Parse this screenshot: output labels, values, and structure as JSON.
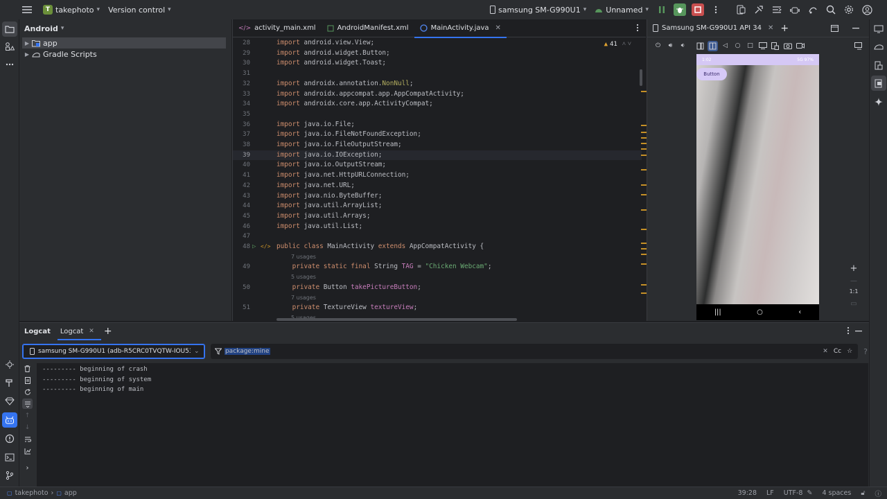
{
  "titlebar": {
    "project_badge": "T",
    "project_name": "takephoto",
    "vcs_label": "Version control",
    "device_name": "samsung SM-G990U1",
    "config_name": "Unnamed"
  },
  "project_panel": {
    "view_mode": "Android",
    "items": [
      {
        "label": "app"
      },
      {
        "label": "Gradle Scripts"
      }
    ]
  },
  "editor": {
    "tabs": [
      {
        "label": "activity_main.xml",
        "icon": "xml-file-icon"
      },
      {
        "label": "AndroidManifest.xml",
        "icon": "manifest-file-icon"
      },
      {
        "label": "MainActivity.java",
        "icon": "java-class-icon"
      }
    ],
    "warnings_count": "41",
    "lines": [
      {
        "n": "28",
        "code": [
          [
            "kw",
            "import "
          ],
          [
            "cls",
            "android.view.View;"
          ]
        ]
      },
      {
        "n": "29",
        "code": [
          [
            "kw",
            "import "
          ],
          [
            "cls",
            "android.widget.Button;"
          ]
        ]
      },
      {
        "n": "30",
        "code": [
          [
            "kw",
            "import "
          ],
          [
            "cls",
            "android.widget.Toast;"
          ]
        ]
      },
      {
        "n": "31",
        "code": []
      },
      {
        "n": "32",
        "code": [
          [
            "kw",
            "import "
          ],
          [
            "cls",
            "androidx.annotation."
          ],
          [
            "ann",
            "NonNull"
          ],
          [
            "cls",
            ";"
          ]
        ]
      },
      {
        "n": "33",
        "code": [
          [
            "kw",
            "import "
          ],
          [
            "cls",
            "androidx.appcompat.app.AppCompatActivity;"
          ]
        ]
      },
      {
        "n": "34",
        "code": [
          [
            "kw",
            "import "
          ],
          [
            "cls",
            "androidx.core.app.ActivityCompat;"
          ]
        ]
      },
      {
        "n": "35",
        "code": []
      },
      {
        "n": "36",
        "code": [
          [
            "kw",
            "import "
          ],
          [
            "cls",
            "java.io.File;"
          ]
        ]
      },
      {
        "n": "37",
        "code": [
          [
            "kw",
            "import "
          ],
          [
            "cls",
            "java.io.FileNotFoundException;"
          ]
        ]
      },
      {
        "n": "38",
        "code": [
          [
            "kw",
            "import "
          ],
          [
            "cls",
            "java.io.FileOutputStream;"
          ]
        ]
      },
      {
        "n": "39",
        "code": [
          [
            "kw",
            "import "
          ],
          [
            "cls",
            "java.io.IOException;"
          ]
        ],
        "current": true
      },
      {
        "n": "40",
        "code": [
          [
            "kw",
            "import "
          ],
          [
            "cls",
            "java.io.OutputStream;"
          ]
        ]
      },
      {
        "n": "41",
        "code": [
          [
            "kw",
            "import "
          ],
          [
            "cls",
            "java.net.HttpURLConnection;"
          ]
        ]
      },
      {
        "n": "42",
        "code": [
          [
            "kw",
            "import "
          ],
          [
            "cls",
            "java.net.URL;"
          ]
        ]
      },
      {
        "n": "43",
        "code": [
          [
            "kw",
            "import "
          ],
          [
            "cls",
            "java.nio.ByteBuffer;"
          ]
        ]
      },
      {
        "n": "44",
        "code": [
          [
            "kw",
            "import "
          ],
          [
            "cls",
            "java.util.ArrayList;"
          ]
        ]
      },
      {
        "n": "45",
        "code": [
          [
            "kw",
            "import "
          ],
          [
            "cls",
            "java.util.Arrays;"
          ]
        ]
      },
      {
        "n": "46",
        "code": [
          [
            "kw",
            "import "
          ],
          [
            "cls",
            "java.util.List;"
          ]
        ]
      },
      {
        "n": "47",
        "code": []
      },
      {
        "n": "48",
        "code": [
          [
            "kw",
            "public class "
          ],
          [
            "cls",
            "MainActivity "
          ],
          [
            "kw",
            "extends "
          ],
          [
            "cls",
            "AppCompatActivity {"
          ]
        ],
        "gutter_icons": true
      },
      {
        "n": "",
        "hint": "7 usages"
      },
      {
        "n": "49",
        "code": [
          [
            "cls",
            "    "
          ],
          [
            "kw",
            "private static final "
          ],
          [
            "cls",
            "String "
          ],
          [
            "fld",
            "TAG"
          ],
          [
            "cls",
            " = "
          ],
          [
            "str",
            "\"Chicken Webcam\""
          ],
          [
            "cls",
            ";"
          ]
        ]
      },
      {
        "n": "",
        "hint": "5 usages"
      },
      {
        "n": "50",
        "code": [
          [
            "cls",
            "    "
          ],
          [
            "kw",
            "private "
          ],
          [
            "cls",
            "Button "
          ],
          [
            "fld",
            "takePictureButton"
          ],
          [
            "cls",
            ";"
          ]
        ]
      },
      {
        "n": "",
        "hint": "7 usages"
      },
      {
        "n": "51",
        "code": [
          [
            "cls",
            "    "
          ],
          [
            "kw",
            "private "
          ],
          [
            "cls",
            "TextureView "
          ],
          [
            "fld",
            "textureView"
          ],
          [
            "cls",
            ";"
          ]
        ]
      },
      {
        "n": "",
        "hint": "5 usages"
      }
    ]
  },
  "emulator": {
    "tab_title": "Samsung SM-G990U1 API 34",
    "phone_status_left": "1:02",
    "phone_status_right": "5G 97%",
    "app_button_label": "Button",
    "zoom_reset_label": "1:1"
  },
  "logcat": {
    "title": "Logcat",
    "tab_label": "Logcat",
    "device_selector": "samsung SM-G990U1 (adb-R5CRC0TVQTW-IOU532.",
    "filter_value": "package:mine",
    "case_label": "Cc",
    "lines": [
      "--------- beginning of crash",
      "--------- beginning of system",
      "--------- beginning of main"
    ]
  },
  "statusbar": {
    "project": "takephoto",
    "module": "app",
    "position": "39:28",
    "line_ending": "LF",
    "encoding": "UTF-8",
    "indent": "4 spaces"
  },
  "colors": {
    "accent": "#3574f0",
    "run": "#57965c",
    "stop": "#c94f4f",
    "keyword": "#cf8e6d",
    "string": "#6aab73",
    "field": "#c77dbb"
  }
}
